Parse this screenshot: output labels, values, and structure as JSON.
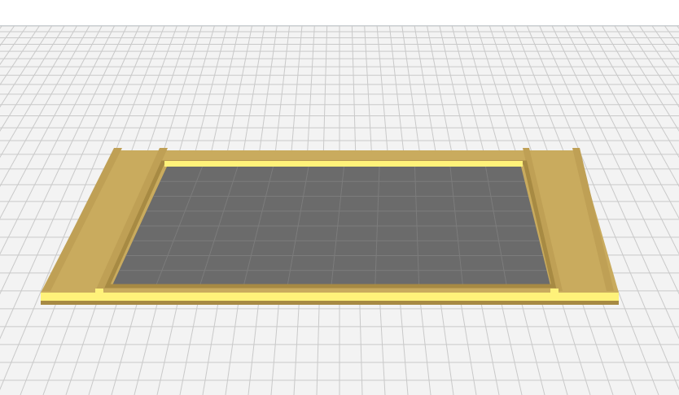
{
  "app": {
    "viewport_label": "",
    "colors": {
      "background": "#ffffff",
      "grid_fill": "#f3f3f3",
      "grid_line": "#c9c9c9",
      "frame_top": "#c9ab5e",
      "frame_side": "#a78a43",
      "frame_edge_highlight": "#fff27a",
      "inner_bed": "#6b6b6b",
      "inner_bed_line": "#7c7c7c"
    },
    "icons": {
      "scene": "3d-model-icon"
    }
  }
}
